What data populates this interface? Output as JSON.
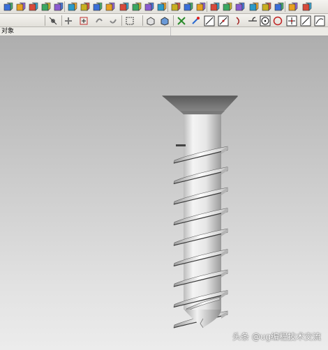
{
  "toolbar": {
    "filter_value": "",
    "icons_row_1": [
      "sketch-icon",
      "extrude-icon",
      "revolve-icon",
      "datum-icon",
      "pattern-icon",
      "cylinder-icon",
      "block-icon",
      "blend-icon",
      "chamfer-icon",
      "hole-icon",
      "shell-icon",
      "boolean-icon",
      "trim-icon",
      "offset-icon",
      "sew-icon",
      "thread-icon",
      "face-icon",
      "draft-icon",
      "mirror-icon",
      "move-icon",
      "scale-icon",
      "wrap-icon",
      "emboss-icon",
      "patch-icon"
    ],
    "icons_row_2": [
      "select-all-icon",
      "deselect-icon",
      "snap-point-icon",
      "undo-select-icon",
      "redo-select-icon",
      "box-select-icon",
      "view-cube-icon",
      "shaded-icon",
      "point-set-icon",
      "fit-icon",
      "line-icon",
      "line-tangent-icon",
      "arc-icon",
      "tangent-arc-icon",
      "circle-center-icon",
      "circle-icon",
      "cross-point-icon",
      "diagonal-line-icon",
      "curve-icon"
    ]
  },
  "object_bar": {
    "label": "对象"
  },
  "watermark": {
    "text": "头条 @ug编程技术交流"
  },
  "colors": {
    "viewport_top": "#aeaeae",
    "viewport_bottom": "#ececec",
    "screw_body": "#e8e8e8",
    "screw_shadow": "#8a8a8a",
    "toolbar_bg": "#e9e7e1"
  }
}
